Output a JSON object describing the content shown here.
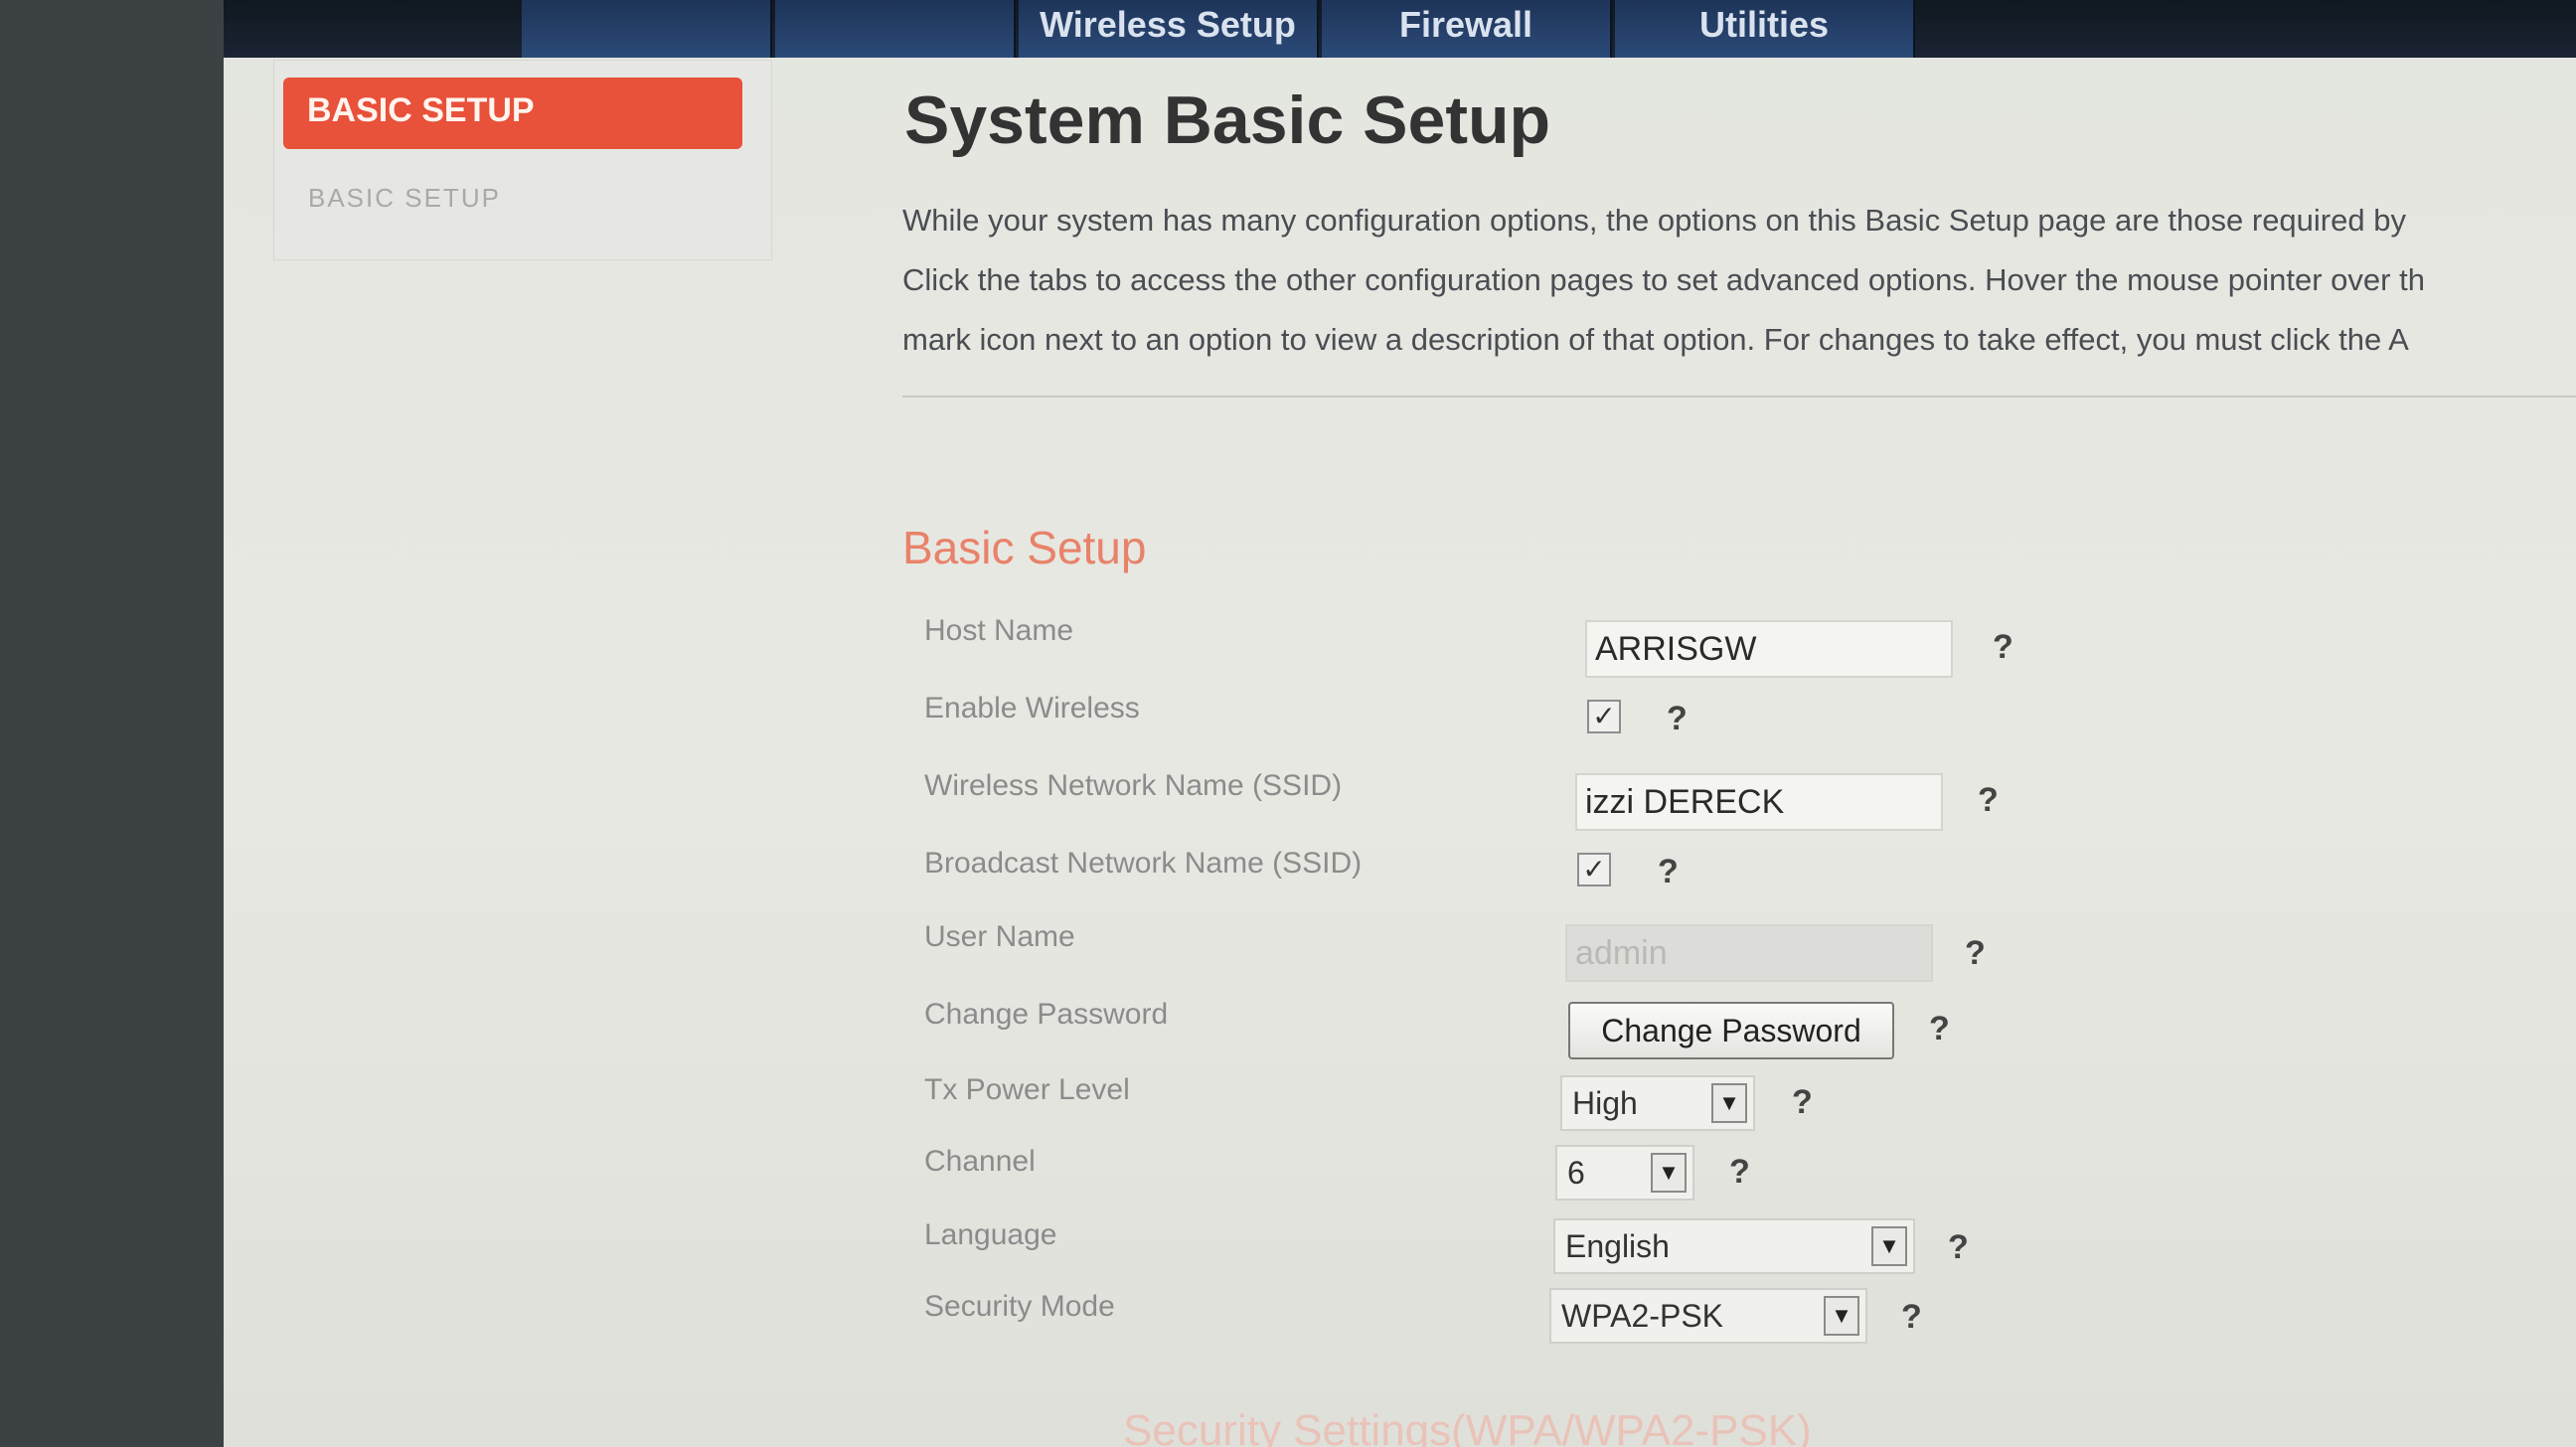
{
  "nav": {
    "tabs": [
      {
        "label": "Wireless Setup"
      },
      {
        "label": "Firewall"
      },
      {
        "label": "Utilities"
      }
    ]
  },
  "sidebar": {
    "active_label": "BASIC SETUP",
    "items": [
      {
        "label": "BASIC SETUP"
      }
    ]
  },
  "page": {
    "title": "System Basic Setup",
    "intro": [
      "While your system has many configuration options, the options on this Basic Setup page are those required by",
      "Click the tabs to access the other configuration pages to set advanced options. Hover the mouse pointer over th",
      "mark icon next to an option to view a description of that option. For changes to take effect, you must click the A"
    ]
  },
  "basic_setup": {
    "title": "Basic Setup",
    "host_name": {
      "label": "Host Name",
      "value": "ARRISGW"
    },
    "enable_wireless": {
      "label": "Enable Wireless",
      "checked": true
    },
    "ssid": {
      "label": "Wireless Network Name (SSID)",
      "value": "izzi DERECK"
    },
    "broadcast_ssid": {
      "label": "Broadcast Network Name (SSID)",
      "checked": true
    },
    "user_name": {
      "label": "User Name",
      "value": "admin"
    },
    "change_password": {
      "label": "Change Password",
      "button": "Change Password"
    },
    "tx_power": {
      "label": "Tx Power Level",
      "value": "High"
    },
    "channel": {
      "label": "Channel",
      "value": "6"
    },
    "language": {
      "label": "Language",
      "value": "English"
    },
    "security_mode": {
      "label": "Security Mode",
      "value": "WPA2-PSK"
    }
  },
  "help_mark": "?",
  "check_mark": "✓",
  "next_section": {
    "title": "Security Settings(WPA/WPA2-PSK)"
  },
  "colors": {
    "accent": "#e8513a",
    "nav": "#2b4a78"
  }
}
